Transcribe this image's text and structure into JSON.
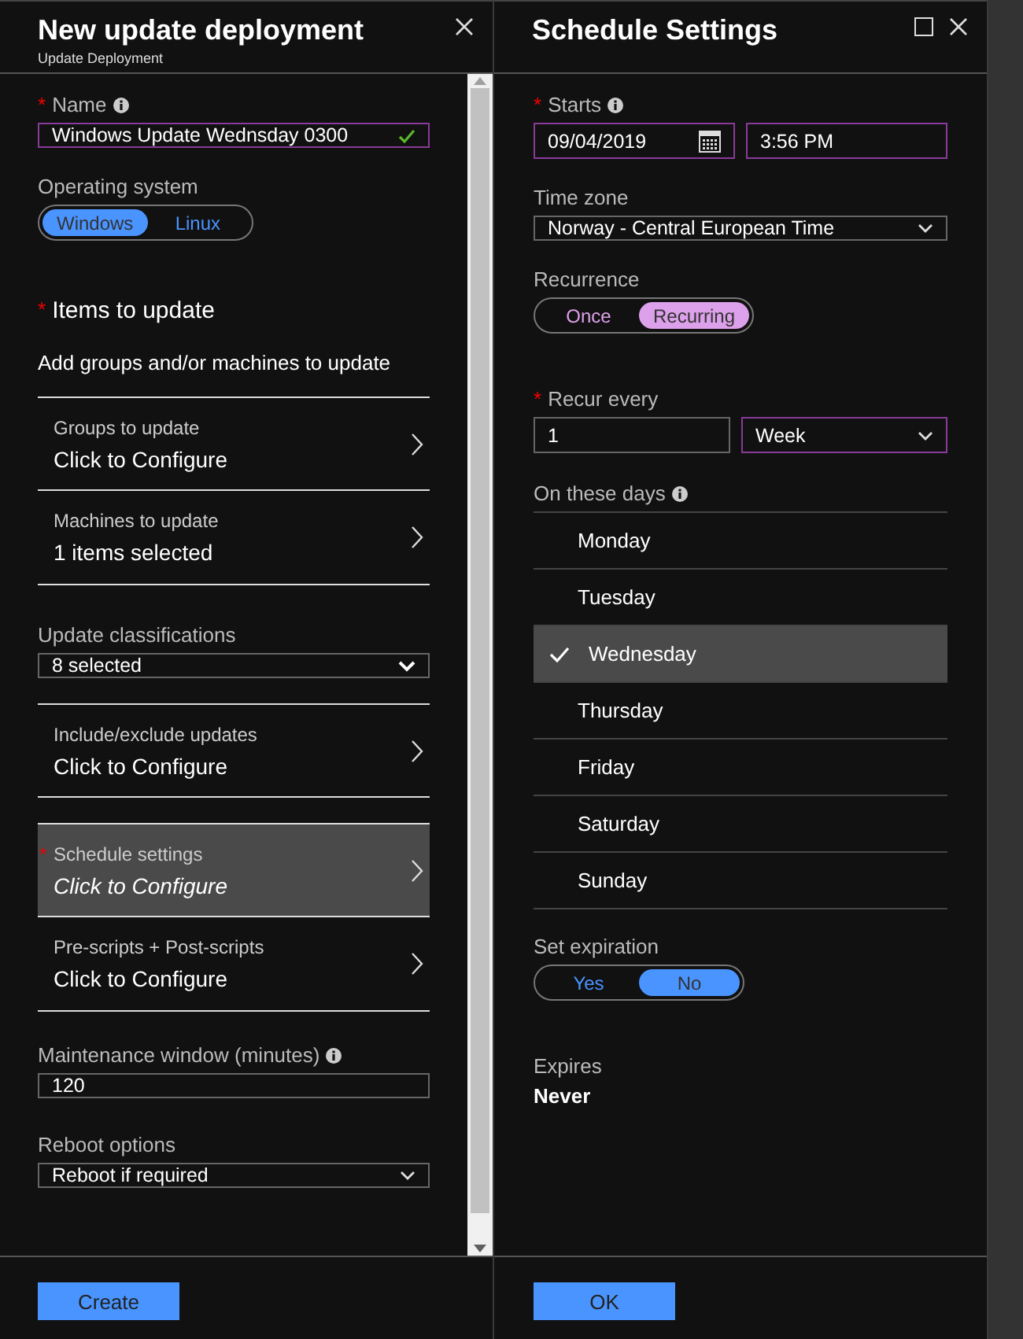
{
  "deployment": {
    "title": "New update deployment",
    "subtitle": "Update Deployment",
    "name": {
      "label": "Name",
      "required_mark": "*",
      "value": "Windows Update Wednsday 0300",
      "valid": true
    },
    "os": {
      "label": "Operating system",
      "options": [
        {
          "label": "Windows",
          "selected": true
        },
        {
          "label": "Linux",
          "selected": false
        }
      ]
    },
    "items_section": {
      "title": "Items to update",
      "required_mark": "*",
      "description": "Add groups and/or machines to update"
    },
    "rows": [
      {
        "kind": "nav",
        "label": "Groups to update",
        "value": "Click to Configure",
        "selected": false
      },
      {
        "kind": "nav",
        "label": "Machines to update",
        "value": "1 items selected",
        "selected": false
      },
      {
        "kind": "dropdown",
        "label": "Update classifications",
        "value": "8 selected"
      },
      {
        "kind": "nav",
        "label": "Include/exclude updates",
        "value": "Click to Configure",
        "selected": false
      },
      {
        "kind": "nav",
        "label": "Schedule settings",
        "value": "Click to Configure",
        "selected": true,
        "required_mark": "*"
      },
      {
        "kind": "nav",
        "label": "Pre-scripts + Post-scripts",
        "value": "Click to Configure",
        "selected": false
      },
      {
        "kind": "input",
        "label": "Maintenance window (minutes)",
        "value": "120",
        "info": true
      },
      {
        "kind": "select",
        "label": "Reboot options",
        "value": "Reboot if required"
      }
    ],
    "create_button": "Create"
  },
  "schedule": {
    "title": "Schedule Settings",
    "starts": {
      "label": "Starts",
      "required_mark": "*",
      "date": "09/04/2019",
      "time": "3:56 PM"
    },
    "time_zone": {
      "label": "Time zone",
      "value": "Norway - Central European Time"
    },
    "recurrence": {
      "label": "Recurrence",
      "options": [
        {
          "label": "Once",
          "selected": false
        },
        {
          "label": "Recurring",
          "selected": true
        }
      ]
    },
    "recur_every": {
      "label": "Recur every",
      "required_mark": "*",
      "value": "1",
      "unit": "Week"
    },
    "days": {
      "label": "On these days",
      "items": [
        {
          "label": "Monday",
          "selected": false
        },
        {
          "label": "Tuesday",
          "selected": false
        },
        {
          "label": "Wednesday",
          "selected": true
        },
        {
          "label": "Thursday",
          "selected": false
        },
        {
          "label": "Friday",
          "selected": false
        },
        {
          "label": "Saturday",
          "selected": false
        },
        {
          "label": "Sunday",
          "selected": false
        }
      ]
    },
    "expiration": {
      "label": "Set expiration",
      "options": [
        {
          "label": "Yes",
          "selected": false
        },
        {
          "label": "No",
          "selected": true
        }
      ]
    },
    "expires": {
      "label": "Expires",
      "value": "Never"
    },
    "ok_button": "OK"
  }
}
